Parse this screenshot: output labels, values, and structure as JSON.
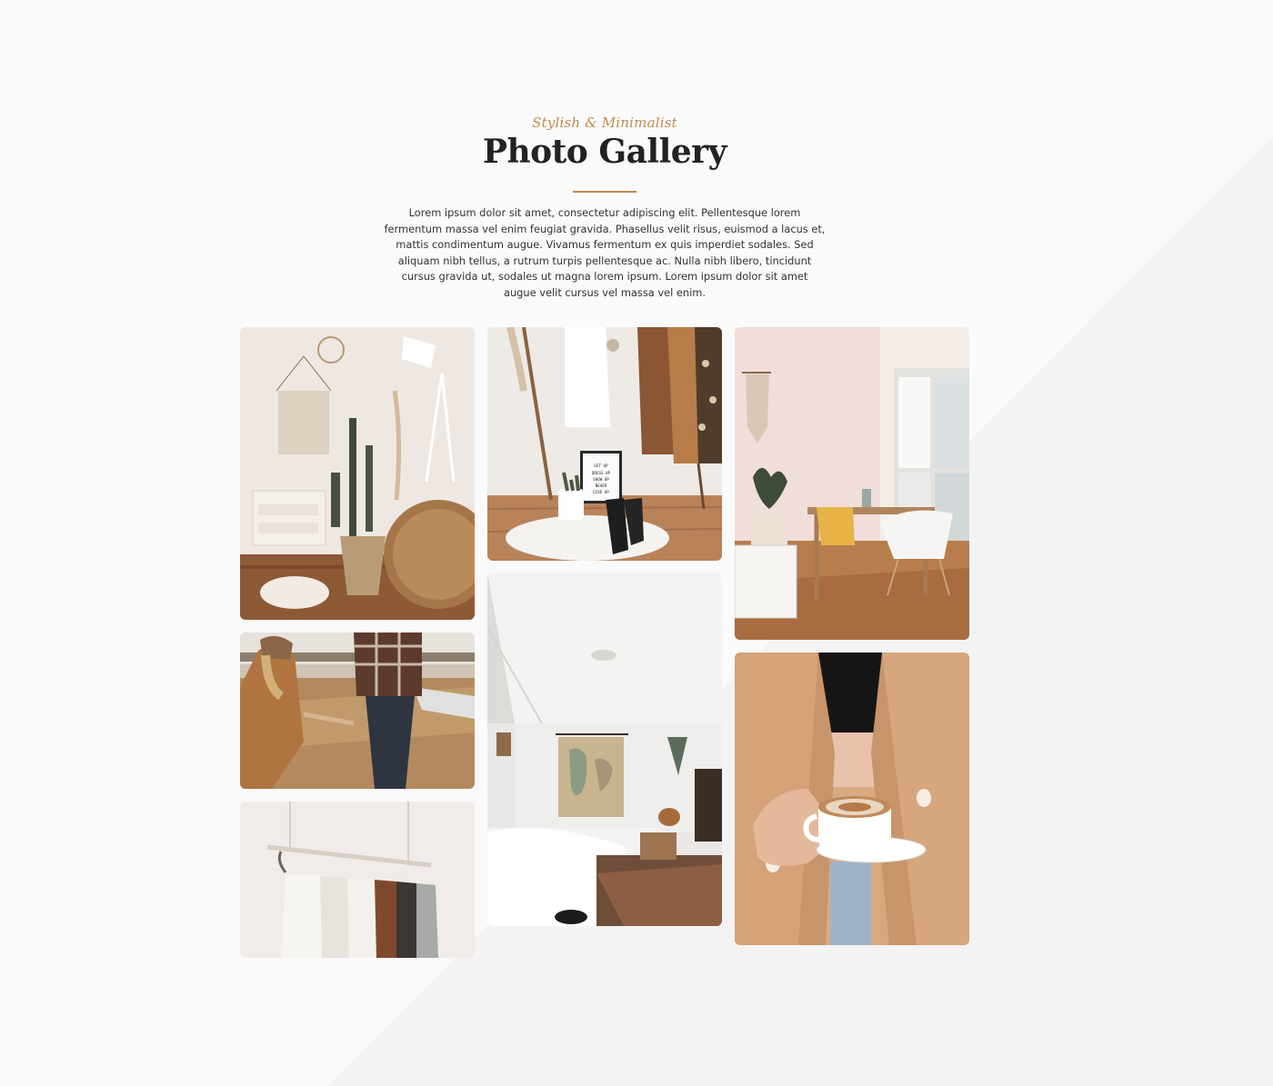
{
  "section": {
    "eyebrow": "Stylish & Minimalist",
    "title": "Photo Gallery",
    "description": "Lorem ipsum dolor sit amet, consectetur adipiscing elit. Pellentesque lorem fermentum massa vel enim feugiat gravida. Phasellus velit risus, euismod a lacus et, mattis condimentum augue. Vivamus fermentum ex quis imperdiet sodales. Sed aliquam nibh tellus, a rutrum turpis pellentesque ac. Nulla nibh libero, tincidunt cursus gravida ut, sodales ut magna lorem ipsum. Lorem ipsum dolor sit amet augue velit cursus vel massa vel enim."
  },
  "colors": {
    "accent": "#c08a4e",
    "title": "#222222",
    "background": "#fafafa",
    "diagonal": "#f3f3f3"
  },
  "gallery": {
    "photos": [
      {
        "subject": "boho bedroom with cactus and rattan chair"
      },
      {
        "subject": "clothes rack with letter board and boots"
      },
      {
        "subject": "bright dining room with window"
      },
      {
        "subject": "couple holding hands in field"
      },
      {
        "subject": "attic bedroom with world map"
      },
      {
        "subject": "woman in camel blazer holding coffee"
      },
      {
        "subject": "hanging clothes rail"
      }
    ],
    "letter_board_text": [
      "GET UP",
      "DRESS UP",
      "SHOW UP",
      "NEVER",
      "GIVE UP"
    ]
  }
}
